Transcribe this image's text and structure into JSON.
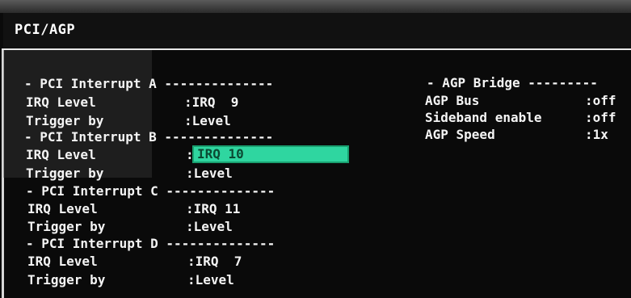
{
  "title": "PCI/AGP",
  "pci_groups": [
    {
      "header": "- PCI Interrupt A --------------",
      "irq_label": "IRQ Level",
      "irq_value": ":IRQ  9",
      "trigger_label": "Trigger by",
      "trigger_value": ":Level"
    },
    {
      "header": "- PCI Interrupt B --------------",
      "irq_label": "IRQ Level",
      "irq_value": ":IRQ 10",
      "trigger_label": "Trigger by",
      "trigger_value": ":Level"
    },
    {
      "header": "- PCI Interrupt C --------------",
      "irq_label": "IRQ Level",
      "irq_value": ":IRQ 11",
      "trigger_label": "Trigger by",
      "trigger_value": ":Level"
    },
    {
      "header": "- PCI Interrupt D --------------",
      "irq_label": "IRQ Level",
      "irq_value": ":IRQ  7",
      "trigger_label": "Trigger by",
      "trigger_value": ":Level"
    }
  ],
  "agp": {
    "header": "- AGP Bridge ---------",
    "items": [
      {
        "label": "AGP Bus",
        "value": ":off"
      },
      {
        "label": "Sideband enable",
        "value": ":off"
      },
      {
        "label": "AGP Speed",
        "value": ":1x"
      }
    ]
  },
  "selection": {
    "colon": ":",
    "text": "IRQ 10",
    "highlight_color": "#2fd6a0"
  }
}
